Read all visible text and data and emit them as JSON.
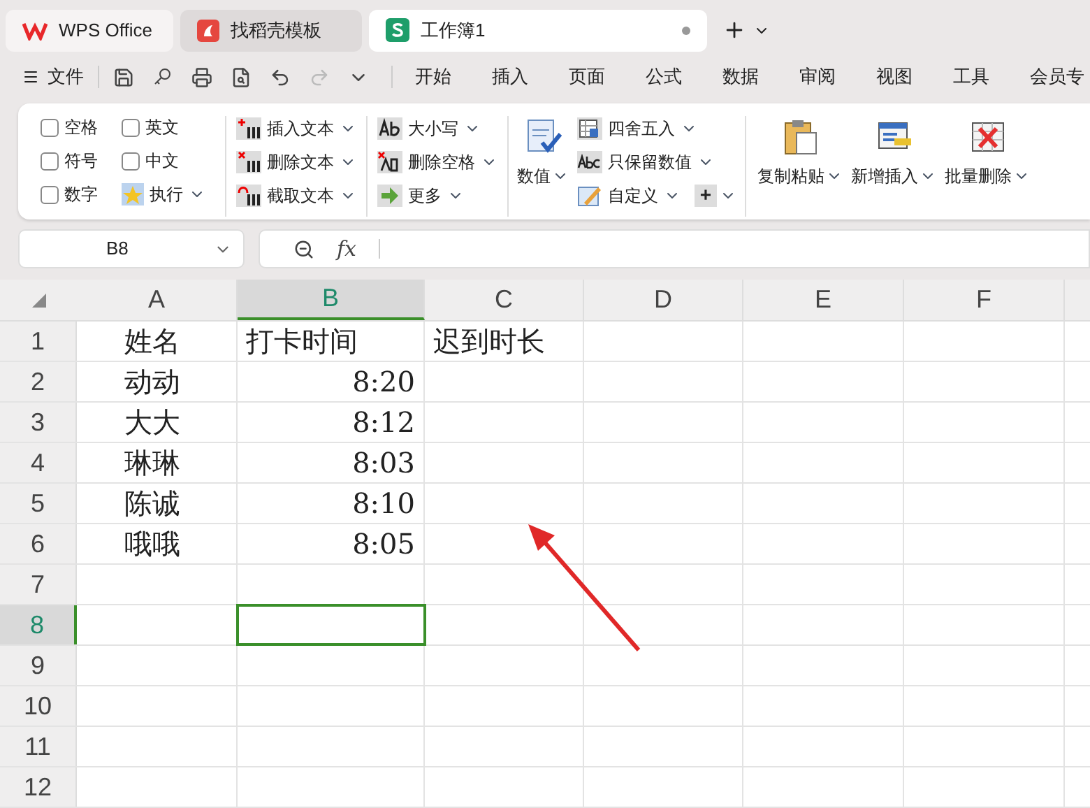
{
  "tabs": [
    {
      "label": "WPS Office",
      "kind": "wps",
      "selected": false
    },
    {
      "label": "找稻壳模板",
      "kind": "docer",
      "selected": false
    },
    {
      "label": "工作簿1",
      "kind": "sheet",
      "selected": true
    }
  ],
  "menu": {
    "file": "文件",
    "items": [
      "开始",
      "插入",
      "页面",
      "公式",
      "数据",
      "审阅",
      "视图",
      "工具",
      "会员专"
    ]
  },
  "ribbon": {
    "checkboxes": [
      {
        "label": "空格",
        "checked": false
      },
      {
        "label": "英文",
        "checked": false
      },
      {
        "label": "符号",
        "checked": false
      },
      {
        "label": "中文",
        "checked": false
      },
      {
        "label": "数字",
        "checked": false
      }
    ],
    "run": "执行",
    "text_tools": [
      {
        "label": "插入文本",
        "kind": "insert"
      },
      {
        "label": "删除文本",
        "kind": "delete"
      },
      {
        "label": "截取文本",
        "kind": "cut"
      }
    ],
    "case_tools": [
      {
        "label": "大小写",
        "kind": "case"
      },
      {
        "label": "删除空格",
        "kind": "space"
      },
      {
        "label": "更多",
        "kind": "more"
      }
    ],
    "value_button": "数值",
    "number_tools": [
      {
        "label": "四舍五入",
        "kind": "round"
      },
      {
        "label": "只保留数值",
        "kind": "keep"
      },
      {
        "label": "自定义",
        "kind": "custom"
      }
    ],
    "plus": "+",
    "big_buttons": [
      {
        "label": "复制粘贴",
        "kind": "paste"
      },
      {
        "label": "新增插入",
        "kind": "add"
      },
      {
        "label": "批量删除",
        "kind": "remove"
      }
    ]
  },
  "name_box": "B8",
  "fx": "fx",
  "columns": [
    {
      "label": "A",
      "selected": false
    },
    {
      "label": "B",
      "selected": true
    },
    {
      "label": "C",
      "selected": false
    },
    {
      "label": "D",
      "selected": false
    },
    {
      "label": "E",
      "selected": false
    },
    {
      "label": "F",
      "selected": false
    }
  ],
  "rows": [
    {
      "header": "1",
      "selected": false,
      "cells": [
        {
          "text": "姓名",
          "numeric": false
        },
        {
          "text": "打卡时间",
          "numeric": false
        },
        {
          "text": "迟到时长",
          "numeric": false
        }
      ]
    },
    {
      "header": "2",
      "selected": false,
      "cells": [
        {
          "text": "动动",
          "numeric": false
        },
        {
          "text": "8:20",
          "numeric": true
        }
      ]
    },
    {
      "header": "3",
      "selected": false,
      "cells": [
        {
          "text": "大大",
          "numeric": false
        },
        {
          "text": "8:12",
          "numeric": true
        }
      ]
    },
    {
      "header": "4",
      "selected": false,
      "cells": [
        {
          "text": "琳琳",
          "numeric": false
        },
        {
          "text": "8:03",
          "numeric": true
        }
      ]
    },
    {
      "header": "5",
      "selected": false,
      "cells": [
        {
          "text": "陈诚",
          "numeric": false
        },
        {
          "text": "8:10",
          "numeric": true
        }
      ]
    },
    {
      "header": "6",
      "selected": false,
      "cells": [
        {
          "text": "哦哦",
          "numeric": false
        },
        {
          "text": "8:05",
          "numeric": true
        }
      ]
    },
    {
      "header": "7",
      "selected": false,
      "cells": []
    },
    {
      "header": "8",
      "selected": true,
      "cells": []
    },
    {
      "header": "9",
      "selected": false,
      "cells": []
    },
    {
      "header": "10",
      "selected": false,
      "cells": []
    },
    {
      "header": "11",
      "selected": false,
      "cells": []
    },
    {
      "header": "12",
      "selected": false,
      "cells": []
    }
  ]
}
